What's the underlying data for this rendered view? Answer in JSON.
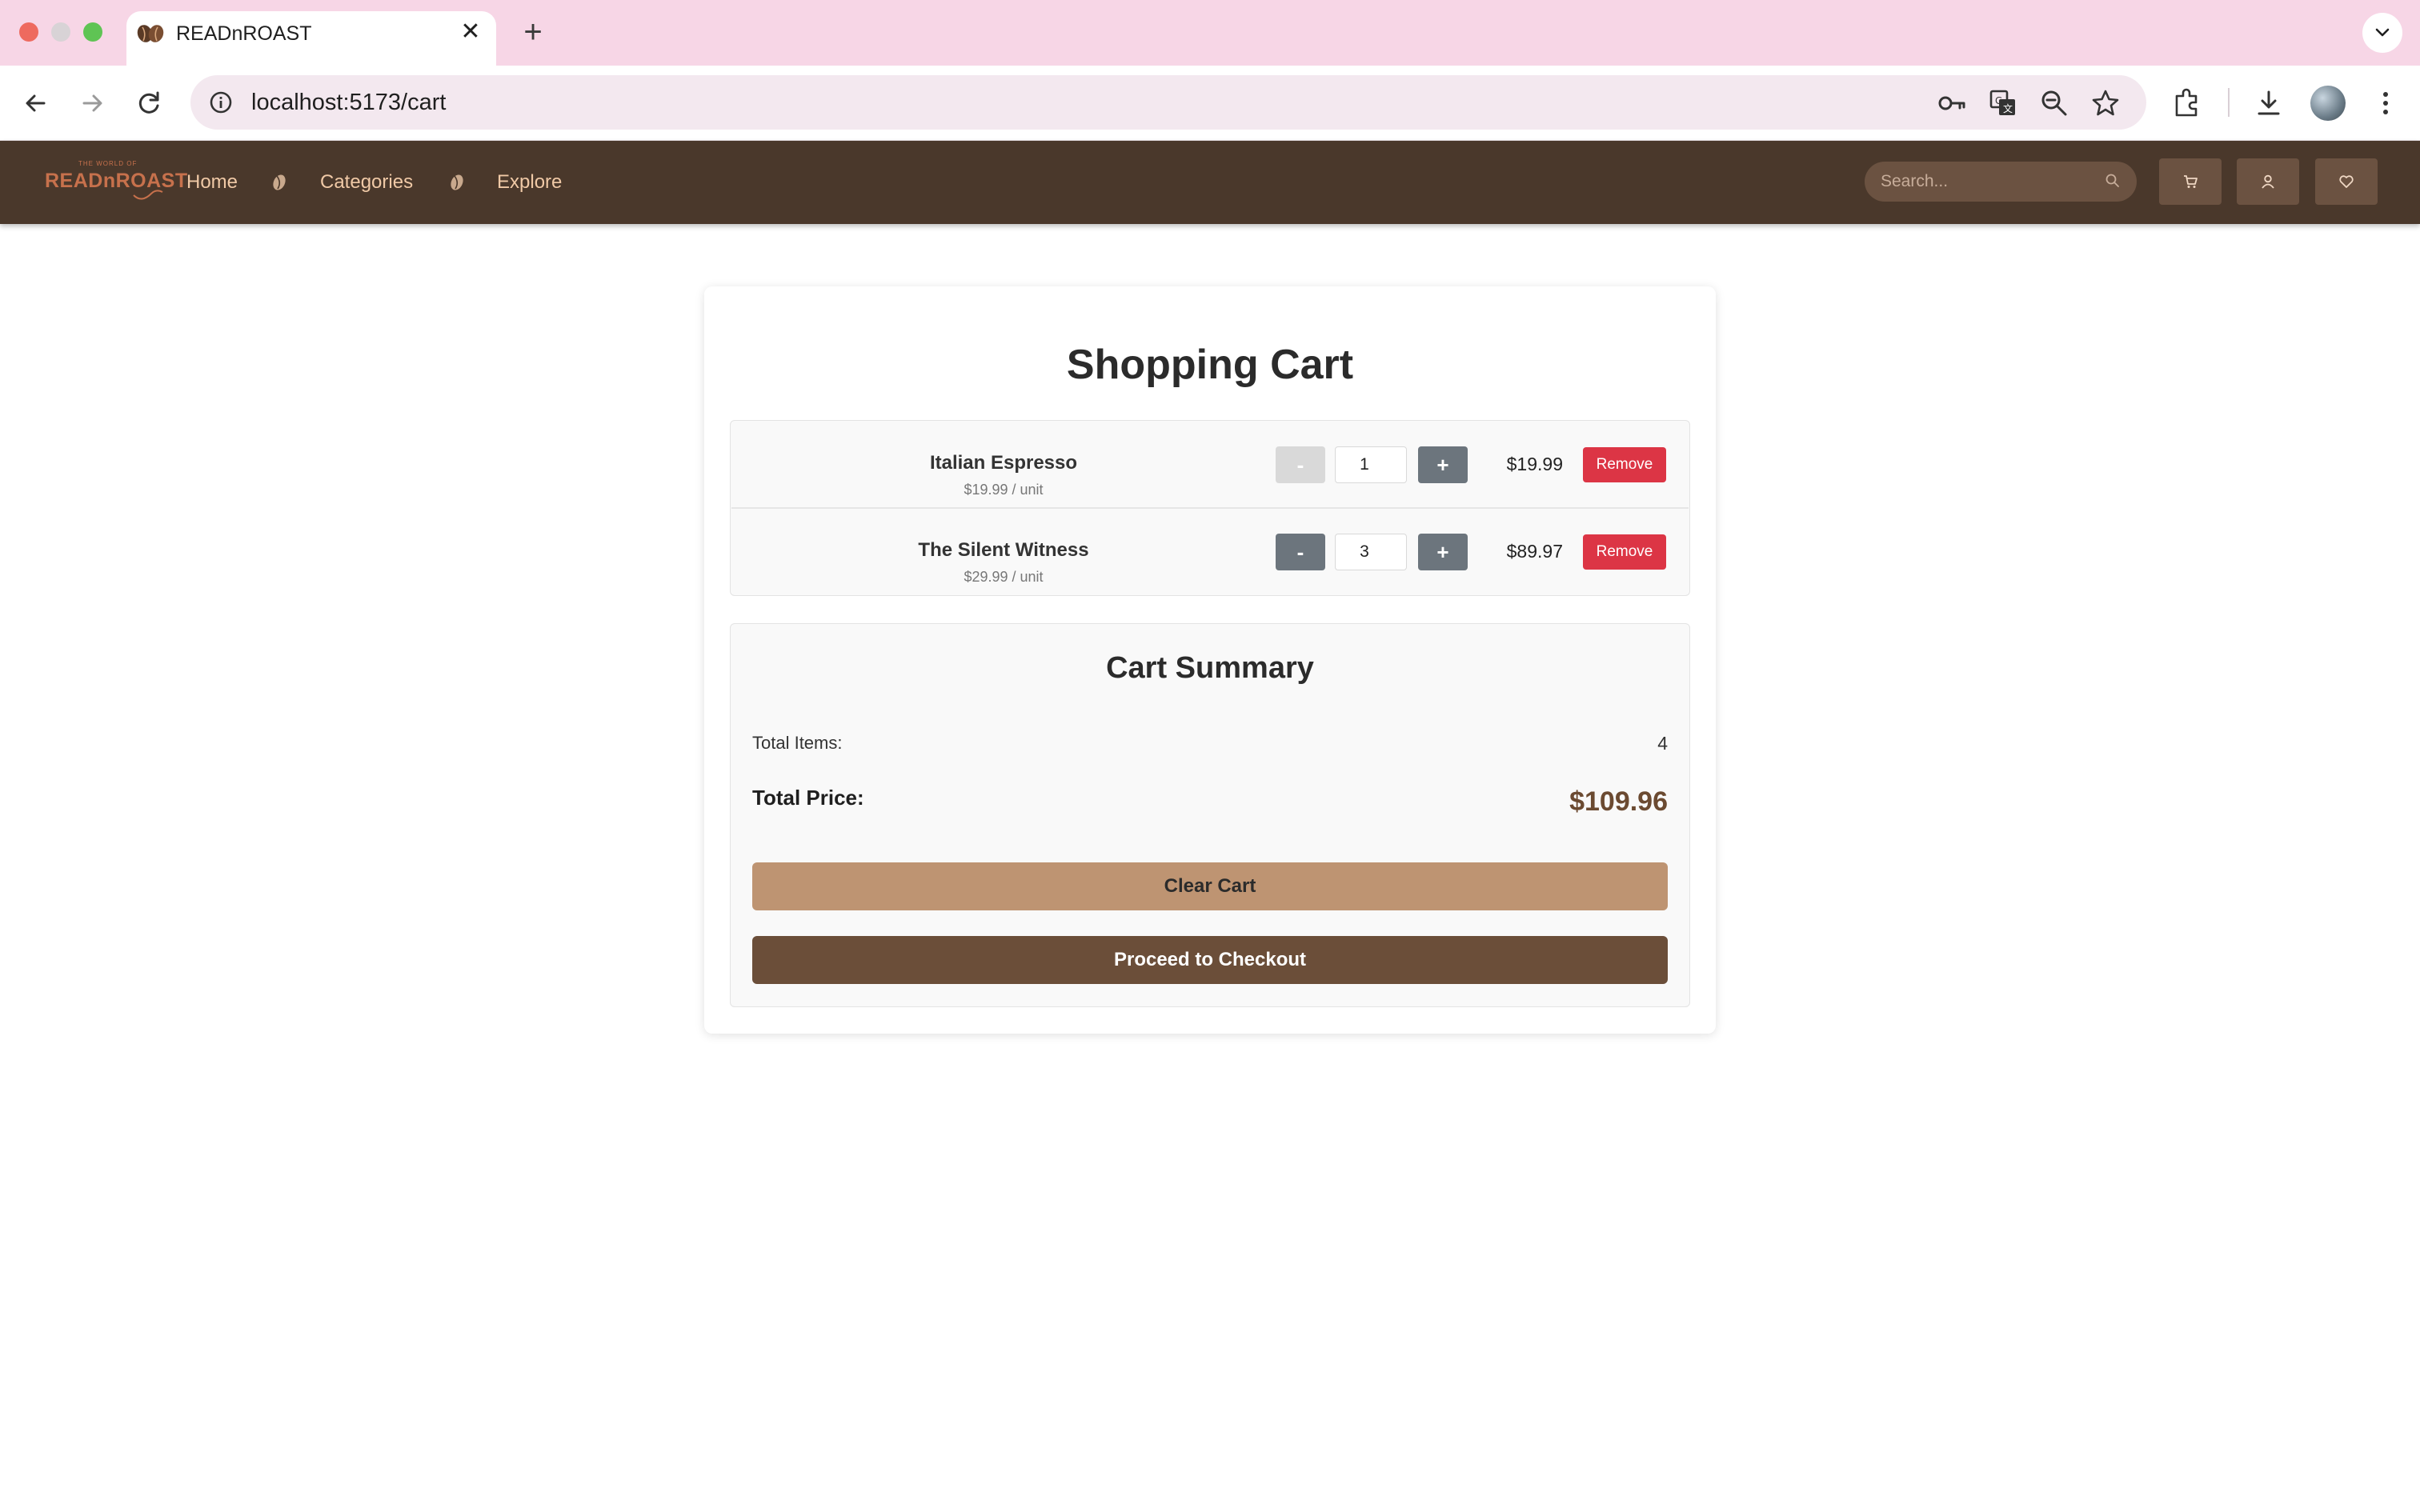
{
  "browser": {
    "tab_title": "READnROAST",
    "url": "localhost:5173/cart",
    "toolbar_icons": [
      "back-icon",
      "forward-icon",
      "reload-icon",
      "site-info-icon",
      "password-key-icon",
      "translate-icon",
      "zoom-icon",
      "bookmark-star-icon",
      "extensions-icon",
      "download-icon",
      "profile-avatar",
      "more-menu-icon"
    ]
  },
  "site": {
    "logo_small": "THE WORLD OF",
    "logo_main": "READnROAST",
    "nav": {
      "home": "Home",
      "categories": "Categories",
      "explore": "Explore"
    },
    "search_placeholder": "Search...",
    "colors": {
      "header_bg": "#4a382b",
      "nav_text": "#f0c9a6",
      "accent": "#6b4e39"
    }
  },
  "cart": {
    "title": "Shopping Cart",
    "items": [
      {
        "name": "Italian Espresso",
        "unit_price": "$19.99 / unit",
        "quantity": "1",
        "total": "$19.99",
        "minus": "-",
        "plus": "+",
        "remove": "Remove"
      },
      {
        "name": "The Silent Witness",
        "unit_price": "$29.99 / unit",
        "quantity": "3",
        "total": "$89.97",
        "minus": "-",
        "plus": "+",
        "remove": "Remove"
      }
    ]
  },
  "summary": {
    "title": "Cart Summary",
    "total_items_label": "Total Items:",
    "total_items_value": "4",
    "total_price_label": "Total Price:",
    "total_price_value": "$109.96",
    "clear_label": "Clear Cart",
    "checkout_label": "Proceed to Checkout"
  }
}
